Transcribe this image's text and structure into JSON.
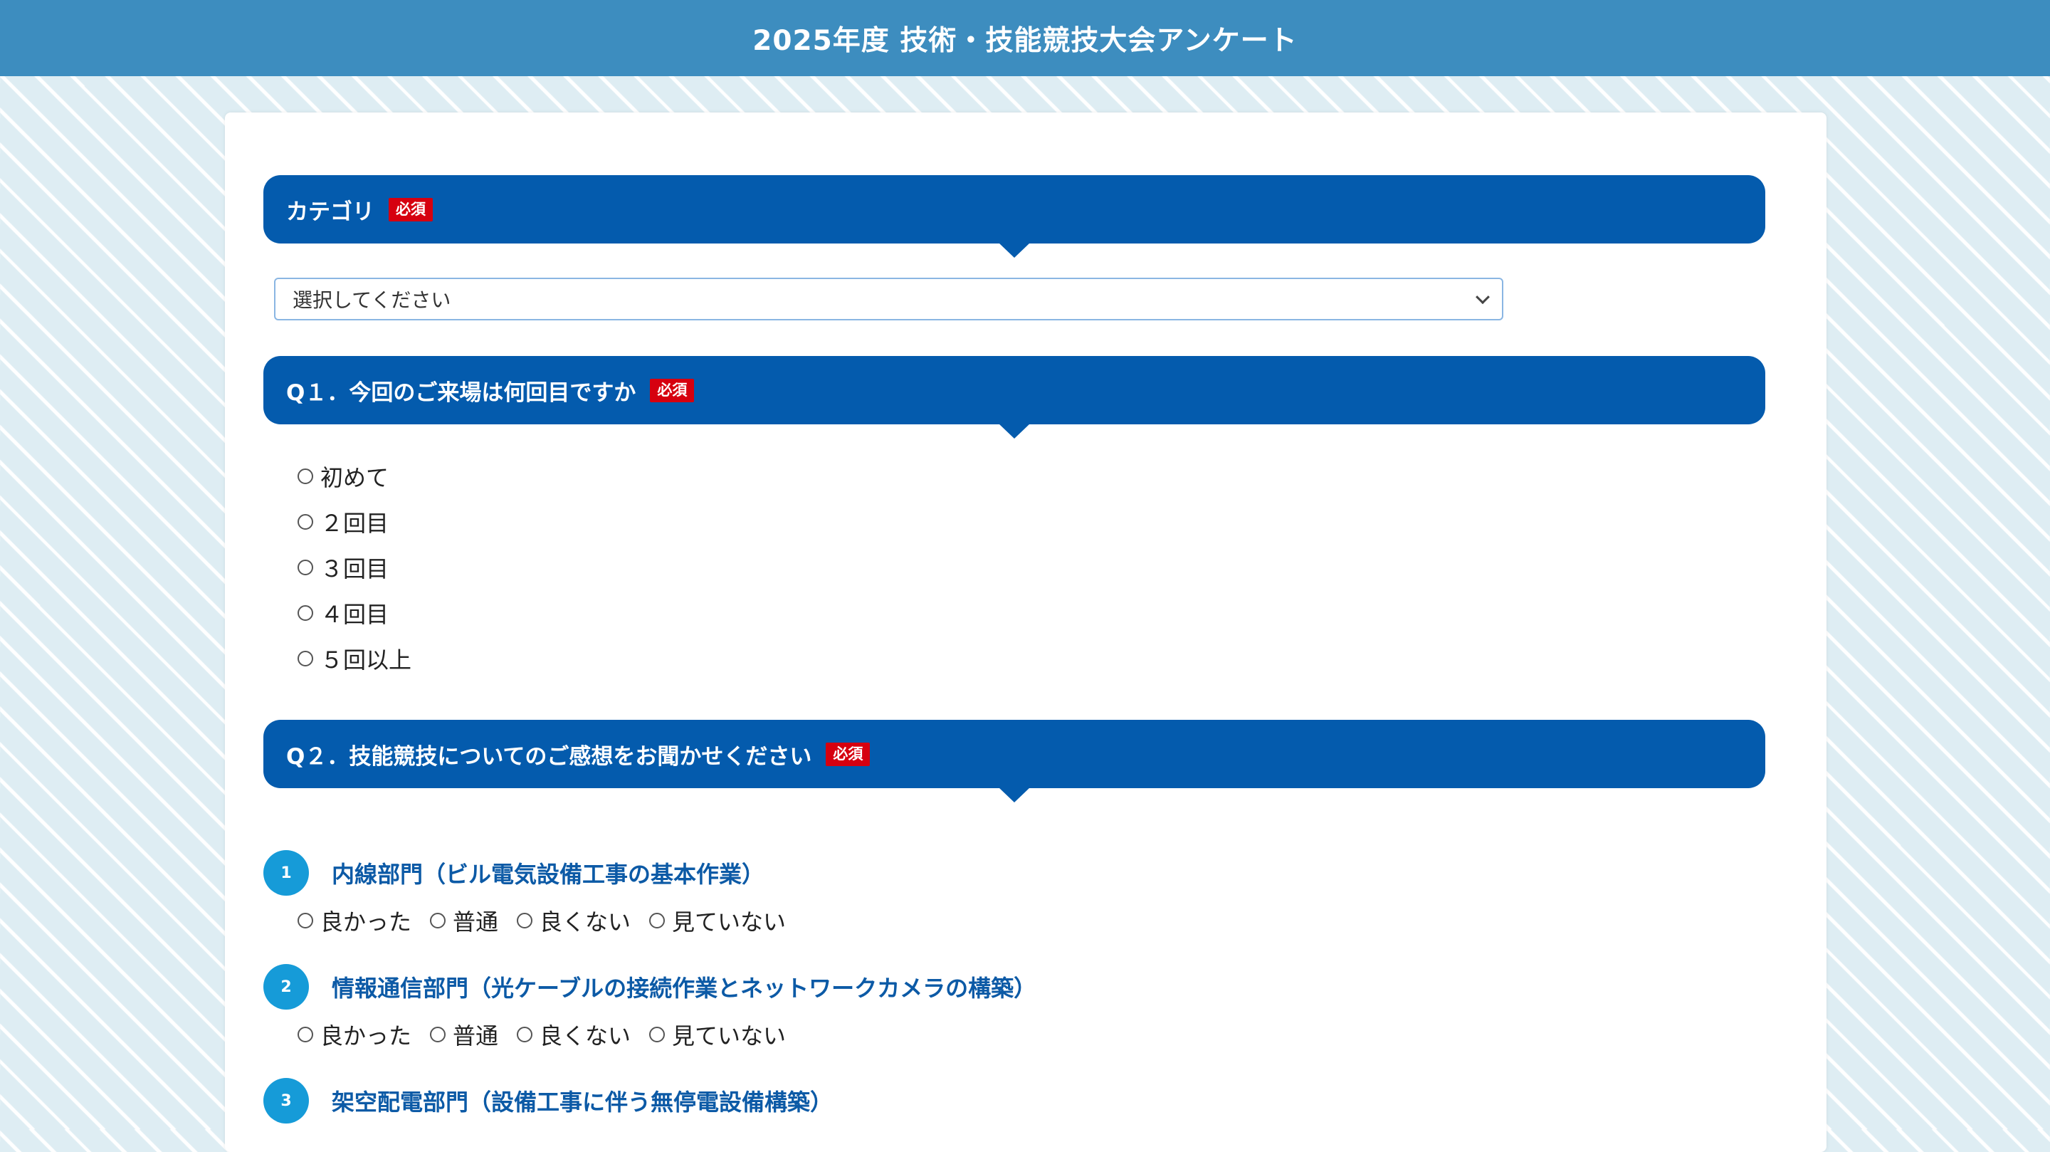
{
  "header": {
    "title": "2025年度 技術・技能競技大会アンケート"
  },
  "required_label": "必須",
  "category": {
    "label": "カテゴリ",
    "select_value": "選択してください"
  },
  "q1": {
    "label": "Q１．今回のご来場は何回目ですか",
    "options": [
      "初めて",
      "２回目",
      "３回目",
      "４回目",
      "５回以上"
    ]
  },
  "q2": {
    "label": "Q２．技能競技についてのご感想をお聞かせください",
    "items": [
      {
        "number": "1",
        "title": "内線部門（ビル電気設備工事の基本作業）"
      },
      {
        "number": "2",
        "title": "情報通信部門（光ケーブルの接続作業とネットワークカメラの構築）"
      },
      {
        "number": "3",
        "title": "架空配電部門（設備工事に伴う無停電設備構築）"
      }
    ],
    "rating_options": [
      "良かった",
      "普通",
      "良くない",
      "見ていない"
    ]
  },
  "colors": {
    "topbar": "#3d8dbf",
    "question_header": "#045bad",
    "required_badge": "#d6000f",
    "number_badge": "#169bd8",
    "sub_title": "#0c5aa6"
  }
}
